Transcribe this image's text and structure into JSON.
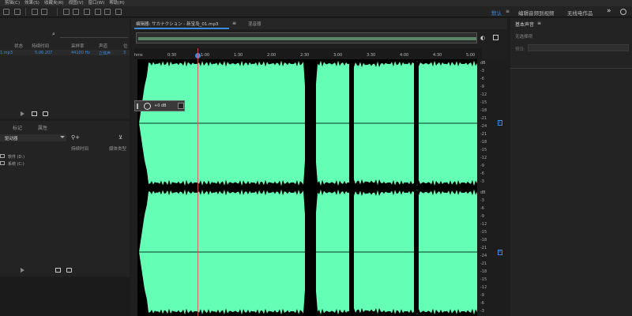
{
  "menu": [
    "剪辑(C)",
    "效果(S)",
    "收藏夹(R)",
    "视图(V)",
    "窗口(W)",
    "帮助(H)"
  ],
  "workspace": {
    "active": "默认",
    "menu_glyph": "≡",
    "edit_video": "编辑音频到视频",
    "no_source": "无线电作品",
    "more": "»"
  },
  "files": {
    "search_glyph": "⌕",
    "columns": [
      "状态",
      "持续时间",
      "采样率",
      "声道",
      "位"
    ],
    "rows": [
      {
        "name": "1.mp3",
        "duration": "5:06.207",
        "rate": "44100 Hz",
        "channels": "立体声",
        "bits": "3"
      }
    ]
  },
  "media": {
    "tabs": [
      "标记",
      "属性"
    ],
    "location": "驱动器",
    "columns": [
      "持续时间",
      "媒体类型"
    ],
    "drives": [
      "软件 (D:)",
      "系统 (C:)"
    ]
  },
  "editor": {
    "tab_title": "编辑器: サカナクション - 新宝岛_01.mp3",
    "tab_menu_glyph": "≡",
    "mixer_tab": "混音器",
    "ruler": [
      "hms",
      "0:30",
      "1:00",
      "1:30",
      "2:00",
      "2:30",
      "3:00",
      "3:30",
      "4:00",
      "4:30",
      "5:00"
    ],
    "hud_gain": "+0 dB",
    "db_labels_top": [
      "dB",
      "-3",
      "-6",
      "-9",
      "-12",
      "-15",
      "-18",
      "-21",
      "-24",
      "-21",
      "-18",
      "-15",
      "-12",
      "-9",
      "-6",
      "-3"
    ],
    "db_labels_bottom": [
      "dB",
      "-3",
      "-6",
      "-9",
      "-12",
      "-15",
      "-18",
      "-21",
      "-24",
      "-21",
      "-18",
      "-15",
      "-12",
      "-9",
      "-6",
      "-3"
    ],
    "channels": [
      "L",
      "R"
    ]
  },
  "essential_sound": {
    "title": "基本声音",
    "menu_glyph": "≡",
    "subtitle": "无选择项",
    "preset_label": "预设:"
  },
  "colors": {
    "waveform": "#64ffb4",
    "accent": "#3d8be0",
    "playhead": "#d84a4a"
  }
}
